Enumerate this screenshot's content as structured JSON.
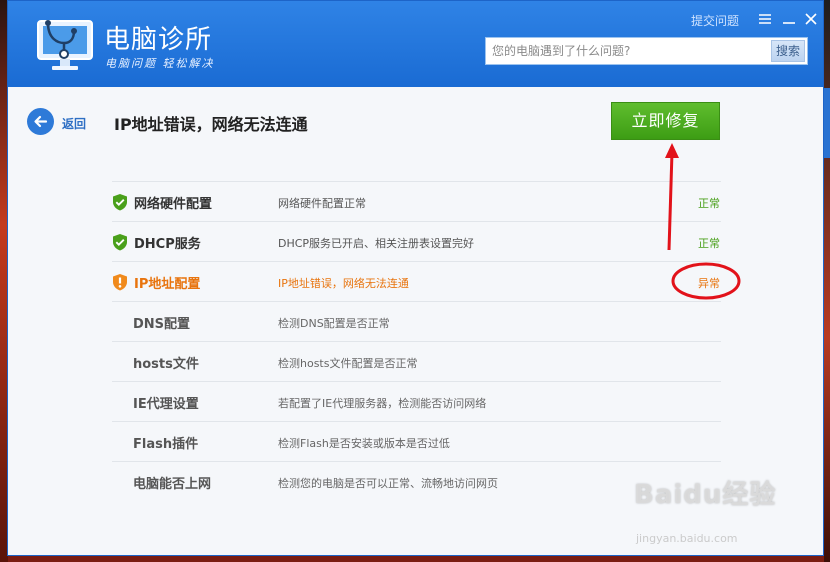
{
  "window": {
    "app_title": "电脑诊所",
    "app_subtitle": "电脑问题 轻松解决",
    "feedback_label": "提交问题",
    "search": {
      "placeholder": "您的电脑遇到了什么问题?",
      "button_label": "搜索"
    }
  },
  "header": {
    "back_label": "返回",
    "headline": "IP地址错误，网络无法连通",
    "fix_button_label": "立即修复"
  },
  "items": [
    {
      "name": "网络硬件配置",
      "desc": "网络硬件配置正常",
      "status": "正常",
      "state": "ok",
      "icon": "check-shield-icon"
    },
    {
      "name": "DHCP服务",
      "desc": "DHCP服务已开启、相关注册表设置完好",
      "status": "正常",
      "state": "ok",
      "icon": "check-shield-icon"
    },
    {
      "name": "IP地址配置",
      "desc": "IP地址错误，网络无法连通",
      "status": "异常",
      "state": "warn",
      "icon": "warning-shield-icon"
    },
    {
      "name": "DNS配置",
      "desc": "检测DNS配置是否正常",
      "status": "",
      "state": "sub"
    },
    {
      "name": "hosts文件",
      "desc": "检测hosts文件配置是否正常",
      "status": "",
      "state": "sub"
    },
    {
      "name": "IE代理设置",
      "desc": "若配置了IE代理服务器，检测能否访问网络",
      "status": "",
      "state": "sub"
    },
    {
      "name": "Flash插件",
      "desc": "检测Flash是否安装或版本是否过低",
      "status": "",
      "state": "sub"
    },
    {
      "name": "电脑能否上网",
      "desc": "检测您的电脑是否可以正常、流畅地访问网页",
      "status": "",
      "state": "sub"
    }
  ],
  "colors": {
    "ok": "#4aa01b",
    "warn": "#e8740e",
    "fix_button": "#4aa81f",
    "title_bar": "#2274da",
    "annotation": "#e2121a"
  },
  "watermark": {
    "logo": "Baidu经验",
    "url": "jingyan.baidu.com"
  }
}
